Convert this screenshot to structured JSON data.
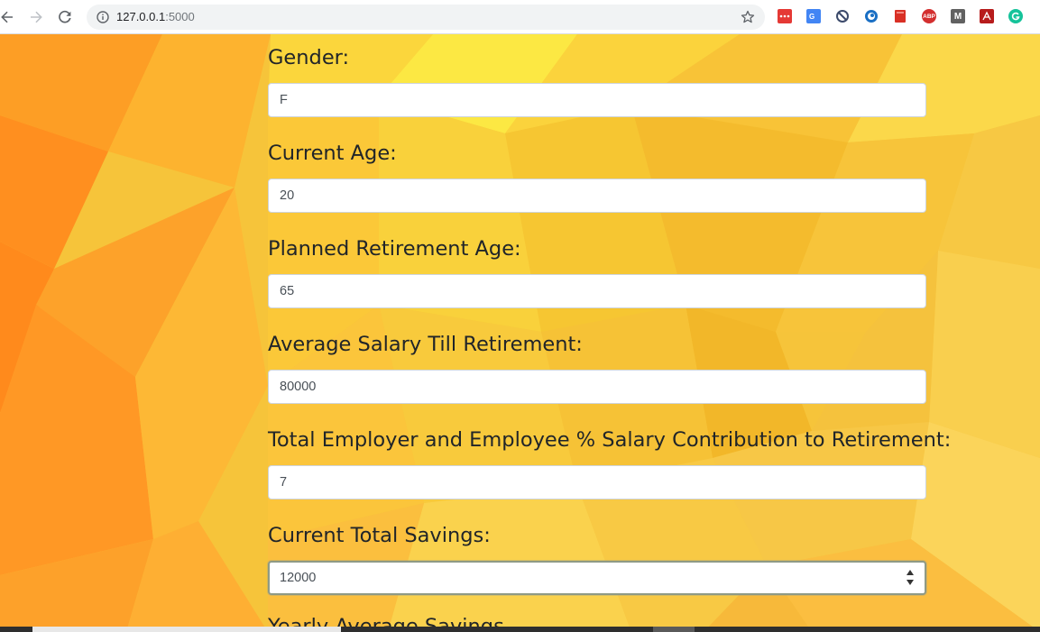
{
  "browser": {
    "url_host": "127.0.0.1",
    "url_port": ":5000",
    "extensions": [
      "more-icon",
      "translate-icon",
      "block-icon",
      "circle-icon",
      "bookmark-icon",
      "adblock-icon",
      "m-icon",
      "pdf-icon",
      "grammarly-icon"
    ],
    "extension_labels": {
      "adblock": "ABP",
      "m": "M"
    }
  },
  "form": {
    "fields": [
      {
        "label": "Gender:",
        "value": "F"
      },
      {
        "label": "Current Age:",
        "value": "20"
      },
      {
        "label": "Planned Retirement Age:",
        "value": "65"
      },
      {
        "label": "Average Salary Till Retirement:",
        "value": "80000"
      },
      {
        "label": "Total Employer and Employee % Salary Contribution to Retirement:",
        "value": "7"
      },
      {
        "label": "Current Total Savings:",
        "value": "12000"
      }
    ],
    "next_label_partial": "Yearly Average Savings"
  },
  "colors": {
    "label_text": "#212529",
    "input_text": "#495057",
    "input_border": "#ced4da",
    "bg_yellow": "#f6c43a",
    "bg_orange": "#ff9a1e"
  }
}
